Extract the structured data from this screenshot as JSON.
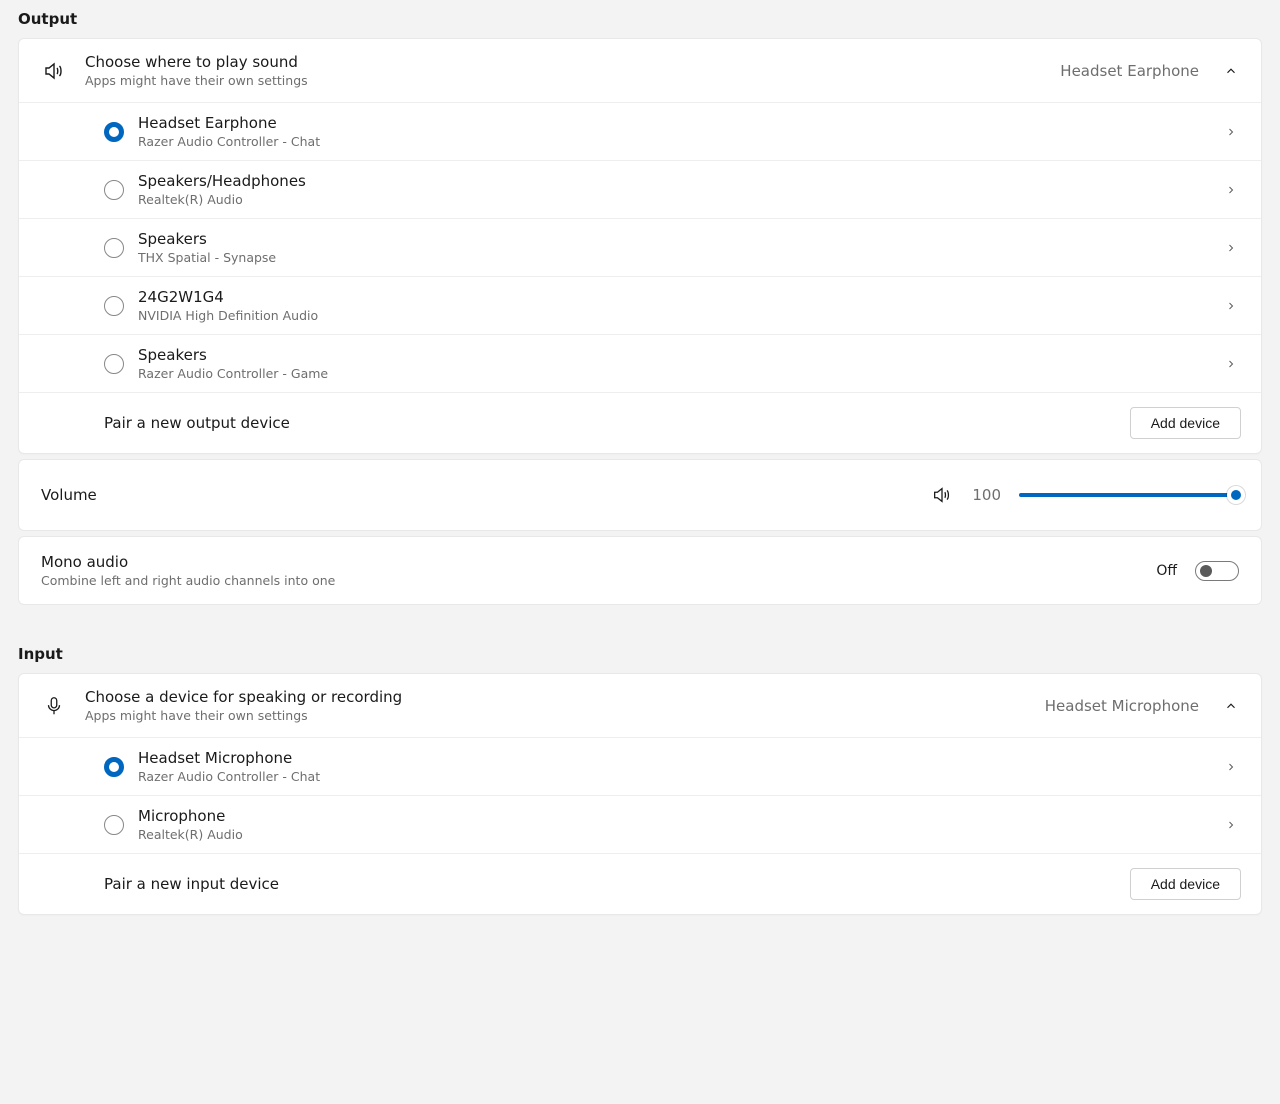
{
  "output": {
    "sectionLabel": "Output",
    "header": {
      "title": "Choose where to play sound",
      "subtitle": "Apps might have their own settings",
      "value": "Headset Earphone"
    },
    "devices": [
      {
        "name": "Headset Earphone",
        "driver": "Razer Audio Controller - Chat",
        "selected": true
      },
      {
        "name": "Speakers/Headphones",
        "driver": "Realtek(R) Audio",
        "selected": false
      },
      {
        "name": "Speakers",
        "driver": "THX Spatial - Synapse",
        "selected": false
      },
      {
        "name": "24G2W1G4",
        "driver": "NVIDIA High Definition Audio",
        "selected": false
      },
      {
        "name": "Speakers",
        "driver": "Razer Audio Controller - Game",
        "selected": false
      }
    ],
    "pair": {
      "label": "Pair a new output device",
      "button": "Add device"
    },
    "volume": {
      "label": "Volume",
      "value": 100
    },
    "mono": {
      "title": "Mono audio",
      "subtitle": "Combine left and right audio channels into one",
      "state": "Off"
    }
  },
  "input": {
    "sectionLabel": "Input",
    "header": {
      "title": "Choose a device for speaking or recording",
      "subtitle": "Apps might have their own settings",
      "value": "Headset Microphone"
    },
    "devices": [
      {
        "name": "Headset Microphone",
        "driver": "Razer Audio Controller - Chat",
        "selected": true
      },
      {
        "name": "Microphone",
        "driver": "Realtek(R) Audio",
        "selected": false
      }
    ],
    "pair": {
      "label": "Pair a new input device",
      "button": "Add device"
    }
  }
}
